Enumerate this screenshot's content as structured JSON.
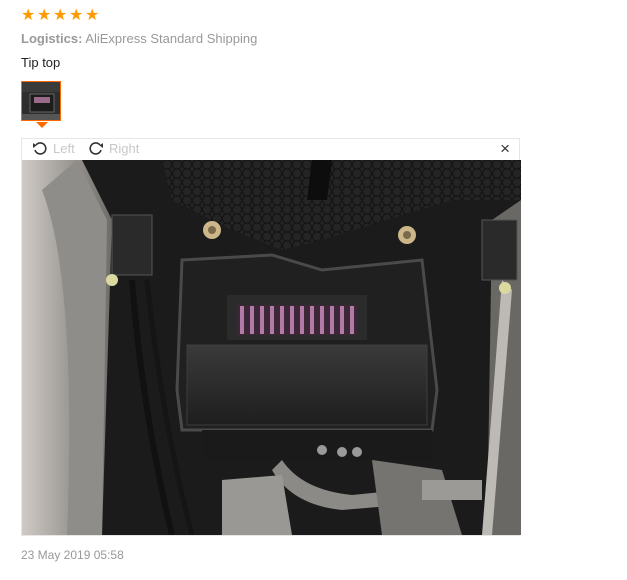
{
  "review": {
    "rating": 5,
    "stars": [
      "★",
      "★",
      "★",
      "★",
      "★"
    ],
    "star_color": "#ff9a00",
    "logistics_label": "Logistics:",
    "logistics_value": "AliExpress Standard Shipping",
    "text": "Tip top",
    "date": "23 May 2019 05:58"
  },
  "viewer": {
    "rotate_left_label": "Left",
    "rotate_right_label": "Right",
    "close_label": "×",
    "accent_color": "#ff6a00"
  }
}
